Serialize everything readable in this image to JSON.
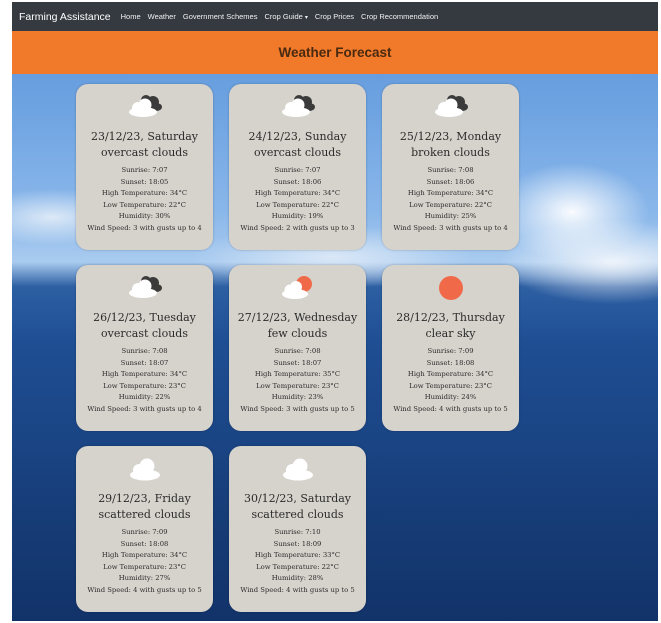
{
  "nav": {
    "brand": "Farming Assistance",
    "links": [
      "Home",
      "Weather",
      "Government Schemes",
      "Crop Guide",
      "Crop Prices",
      "Crop Recommendation"
    ],
    "dropdown_caret": "▾"
  },
  "banner": {
    "title": "Weather Forecast"
  },
  "labels": {
    "sunrise": "Sunrise: ",
    "sunset": "Sunset: ",
    "high": "High Temperature: ",
    "low": "Low Temperature: ",
    "humidity": "Humidity: ",
    "wind": "Wind Speed: "
  },
  "forecast": [
    {
      "date": "23/12/23, Saturday",
      "desc": "overcast clouds",
      "icon": "overcast-clouds-icon",
      "sunrise": "7:07",
      "sunset": "18:05",
      "high": "34°C",
      "low": "22°C",
      "humidity": "30%",
      "wind": "3 with gusts up to 4"
    },
    {
      "date": "24/12/23, Sunday",
      "desc": "overcast clouds",
      "icon": "overcast-clouds-icon",
      "sunrise": "7:07",
      "sunset": "18:06",
      "high": "34°C",
      "low": "22°C",
      "humidity": "19%",
      "wind": "2 with gusts up to 3"
    },
    {
      "date": "25/12/23, Monday",
      "desc": "broken clouds",
      "icon": "broken-clouds-icon",
      "sunrise": "7:08",
      "sunset": "18:06",
      "high": "34°C",
      "low": "22°C",
      "humidity": "25%",
      "wind": "3 with gusts up to 4"
    },
    {
      "date": "26/12/23, Tuesday",
      "desc": "overcast clouds",
      "icon": "overcast-clouds-icon",
      "sunrise": "7:08",
      "sunset": "18:07",
      "high": "34°C",
      "low": "23°C",
      "humidity": "22%",
      "wind": "3 with gusts up to 4"
    },
    {
      "date": "27/12/23, Wednesday",
      "desc": "few clouds",
      "icon": "few-clouds-icon",
      "sunrise": "7:08",
      "sunset": "18:07",
      "high": "35°C",
      "low": "23°C",
      "humidity": "23%",
      "wind": "3 with gusts up to 5"
    },
    {
      "date": "28/12/23, Thursday",
      "desc": "clear sky",
      "icon": "sun-icon",
      "sunrise": "7:09",
      "sunset": "18:08",
      "high": "34°C",
      "low": "23°C",
      "humidity": "24%",
      "wind": "4 with gusts up to 5"
    },
    {
      "date": "29/12/23, Friday",
      "desc": "scattered clouds",
      "icon": "scattered-clouds-icon",
      "sunrise": "7:09",
      "sunset": "18:08",
      "high": "34°C",
      "low": "23°C",
      "humidity": "27%",
      "wind": "4 with gusts up to 5"
    },
    {
      "date": "30/12/23, Saturday",
      "desc": "scattered clouds",
      "icon": "scattered-clouds-icon",
      "sunrise": "7:10",
      "sunset": "18:09",
      "high": "33°C",
      "low": "22°C",
      "humidity": "28%",
      "wind": "4 with gusts up to 5"
    }
  ],
  "colors": {
    "navbar": "#343a40",
    "banner": "#f0792a",
    "card": "#d6d2cc",
    "sun": "#f06a4a"
  }
}
